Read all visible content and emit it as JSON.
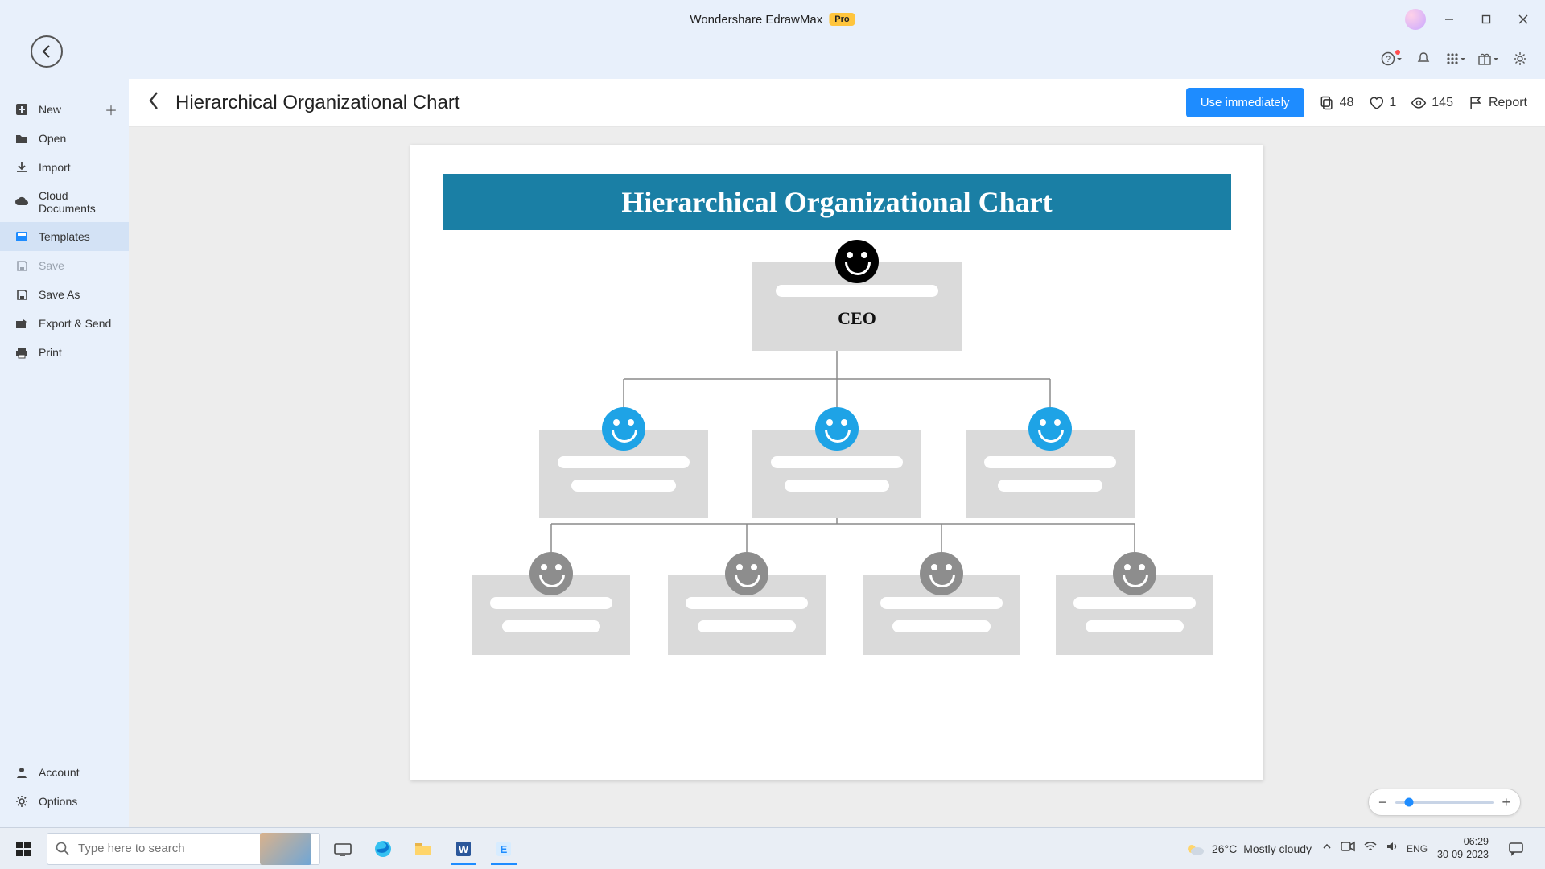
{
  "app": {
    "title": "Wondershare EdrawMax",
    "badge": "Pro"
  },
  "sidebar": {
    "items": [
      {
        "label": "New",
        "icon": "plus-square"
      },
      {
        "label": "Open",
        "icon": "folder"
      },
      {
        "label": "Import",
        "icon": "import"
      },
      {
        "label": "Cloud Documents",
        "icon": "cloud"
      },
      {
        "label": "Templates",
        "icon": "template"
      },
      {
        "label": "Save",
        "icon": "save"
      },
      {
        "label": "Save As",
        "icon": "save-as"
      },
      {
        "label": "Export & Send",
        "icon": "export"
      },
      {
        "label": "Print",
        "icon": "print"
      }
    ],
    "bottom": [
      {
        "label": "Account",
        "icon": "user"
      },
      {
        "label": "Options",
        "icon": "gear"
      }
    ]
  },
  "template": {
    "title": "Hierarchical Organizational Chart",
    "use_label": "Use immediately",
    "copies": "48",
    "likes": "1",
    "views": "145",
    "report_label": "Report"
  },
  "chart": {
    "banner": "Hierarchical Organizational Chart",
    "root_label": "CEO"
  },
  "chart_data": {
    "type": "tree",
    "title": "Hierarchical Organizational Chart",
    "root": {
      "label": "CEO",
      "face": "black",
      "children": [
        {
          "label": "",
          "face": "blue",
          "children": []
        },
        {
          "label": "",
          "face": "blue",
          "children": [
            {
              "label": "",
              "face": "gray"
            },
            {
              "label": "",
              "face": "gray"
            },
            {
              "label": "",
              "face": "gray"
            },
            {
              "label": "",
              "face": "gray"
            }
          ]
        },
        {
          "label": "",
          "face": "blue",
          "children": []
        }
      ]
    }
  },
  "taskbar": {
    "search_placeholder": "Type here to search",
    "weather_temp": "26°C",
    "weather_desc": "Mostly cloudy",
    "time": "06:29",
    "date": "30-09-2023"
  }
}
